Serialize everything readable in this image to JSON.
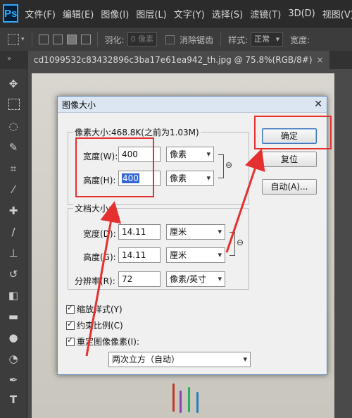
{
  "menubar": {
    "logo": "Ps",
    "items": [
      "文件(F)",
      "编辑(E)",
      "图像(I)",
      "图层(L)",
      "文字(Y)",
      "选择(S)",
      "滤镜(T)",
      "3D(D)",
      "视图(V)"
    ]
  },
  "options": {
    "feather_label": "羽化:",
    "feather_value": "0 像素",
    "antialias_label": "消除锯齿",
    "style_label": "样式:",
    "style_value": "正常",
    "width_label": "宽度:"
  },
  "document_tab": {
    "title": "cd1099532c83432896c3ba17e61ea942_th.jpg @ 75.8%(RGB/8#)",
    "close": "×"
  },
  "dialog": {
    "title": "图像大小",
    "close": "✕",
    "pixel_dimensions": {
      "legend": "像素大小:468.8K(之前为1.03M)",
      "width_label": "宽度(W):",
      "width_value": "400",
      "width_unit": "像素",
      "height_label": "高度(H):",
      "height_value": "400",
      "height_unit": "像素"
    },
    "document_size": {
      "legend": "文档大小:",
      "width_label": "宽度(D):",
      "width_value": "14.11",
      "width_unit": "厘米",
      "height_label": "高度(G):",
      "height_value": "14.11",
      "height_unit": "厘米",
      "resolution_label": "分辨率(R):",
      "resolution_value": "72",
      "resolution_unit": "像素/英寸"
    },
    "checkboxes": {
      "scale_styles": "缩放样式(Y)",
      "constrain": "约束比例(C)",
      "resample": "重定图像像素(I):"
    },
    "resample_method": "两次立方（自动）",
    "buttons": {
      "ok": "确定",
      "reset": "复位",
      "auto": "自动(A)..."
    }
  },
  "colors": {
    "annotation_red": "#e53030",
    "ps_blue": "#31a8ff"
  }
}
